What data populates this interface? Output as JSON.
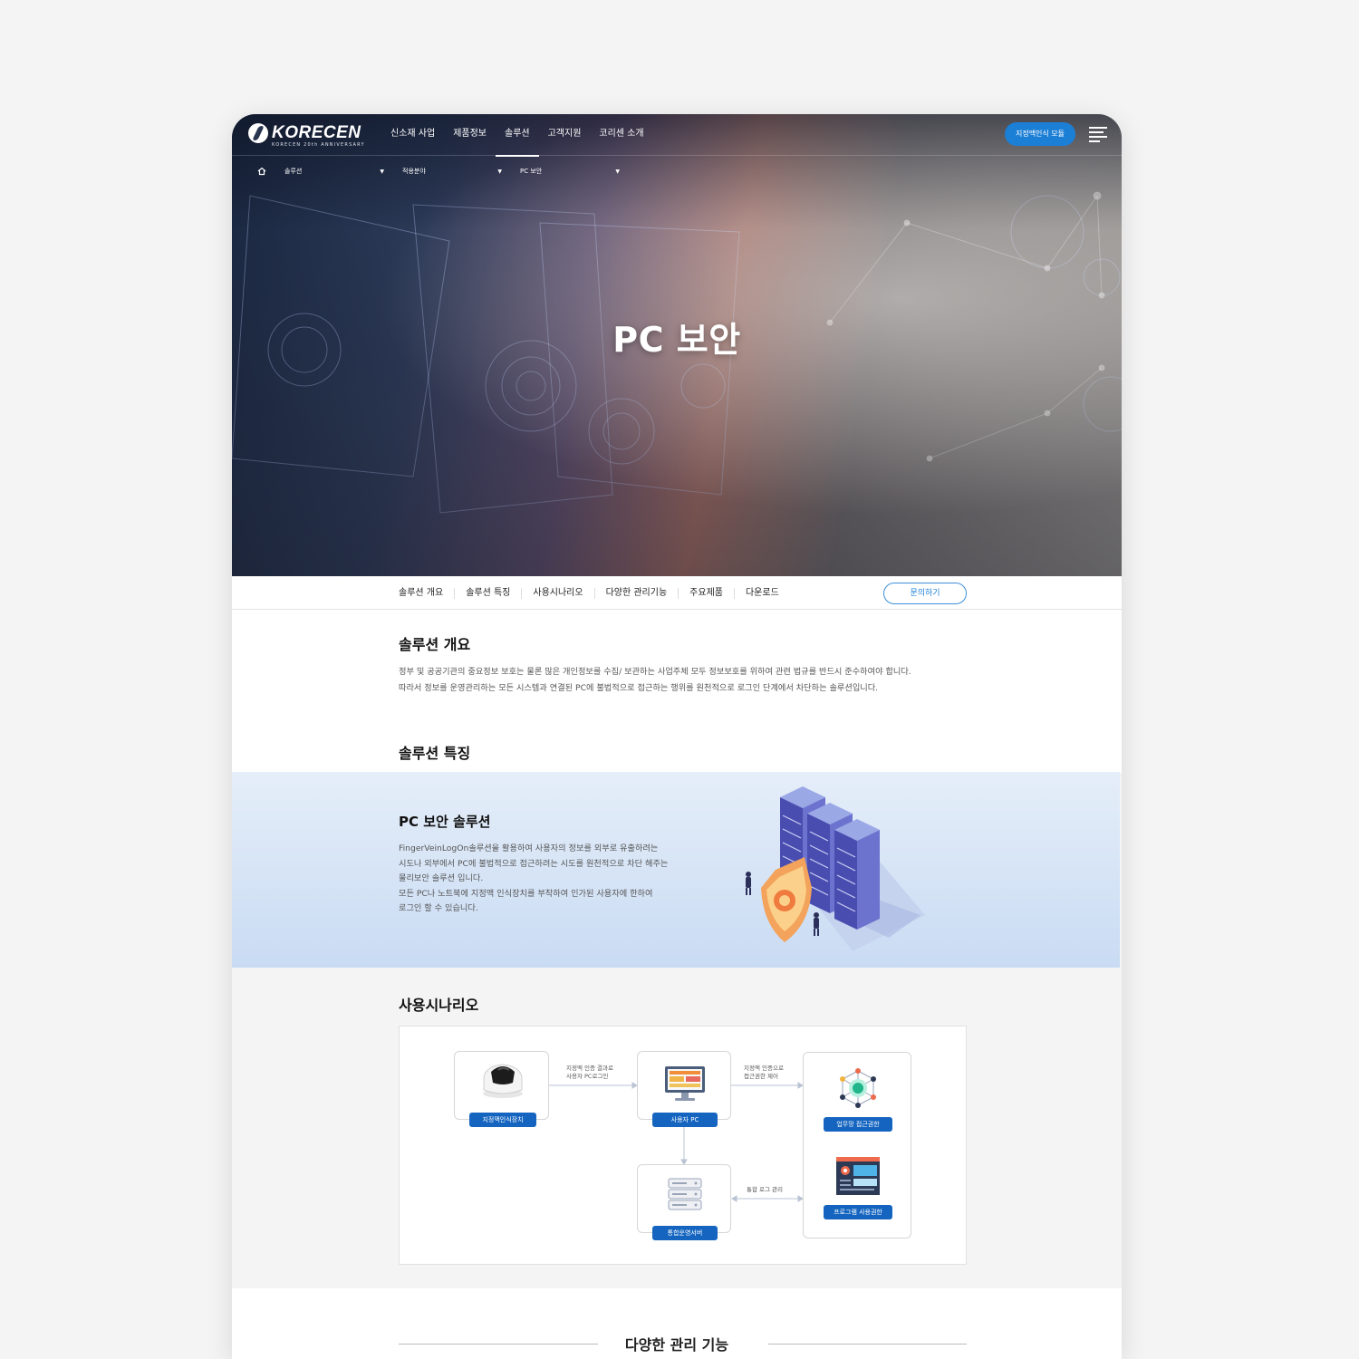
{
  "header": {
    "logo_text": "KORECEN",
    "logo_sub": "KORECEN 20th ANNIVERSARY",
    "nav": [
      "신소재 사업",
      "제품정보",
      "솔루션",
      "고객지원",
      "코리센 소개"
    ],
    "active_nav": "솔루션",
    "module_button": "지정맥인식 모듈"
  },
  "breadcrumb": [
    "솔루션",
    "적용분야",
    "PC 보안"
  ],
  "hero": {
    "title": "PC 보안"
  },
  "subnav": {
    "items": [
      "솔루션 개요",
      "솔루션 특징",
      "사용시나리오",
      "다양한 관리기능",
      "주요제품",
      "다운로드"
    ],
    "inquiry_button": "문의하기"
  },
  "overview": {
    "heading": "솔루션 개요",
    "lines": [
      "정부 및 공공기관의 중요정보 보호는 물론 많은 개인정보를 수집/ 보관하는 사업주체 모두 정보보호를 위하여 관련 법규를 반드시 준수하여야 합니다.",
      "따라서 정보를 운영관리하는 모든 시스템과 연결된 PC에 불법적으로 접근하는 행위를 원천적으로 로그인 단계에서 차단하는 솔루션입니다."
    ]
  },
  "features": {
    "heading": "솔루션 특징",
    "title": "PC 보안 솔루션",
    "lines": [
      "FingerVeinLogOn솔루션을 활용하여 사용자의 정보를 외부로 유출하려는",
      "시도나 외부에서 PC에 불법적으로 접근하려는 시도를 원천적으로 차단 해주는",
      "물리보안 솔루션 입니다.",
      "모든 PC나 노트북에 지정맥 인식장치를 부착하여 인가된 사용자에 한하여",
      "로그인 할 수 있습니다."
    ]
  },
  "scenario": {
    "heading": "사용시나리오",
    "nodes": {
      "device": "지정맥인식장치",
      "pc": "사용자 PC",
      "server": "통합운영서버",
      "access": "업무망 접근권한",
      "program": "프로그램 사용권한"
    },
    "edges": {
      "device_pc": [
        "지정맥 인증 결과로",
        "사용자 PC로그인"
      ],
      "pc_rights": [
        "지정맥 인증으로",
        "접근권한 제어"
      ],
      "server_rights": "통합 로그 관리"
    }
  },
  "management": {
    "heading": "다양한 관리 기능"
  },
  "colors": {
    "accent": "#1c7fd6",
    "label_blue": "#1565c0",
    "feature_bg": "#d4e3f6"
  },
  "icons": [
    "logo-mark",
    "home-icon",
    "caret-down-icon",
    "hamburger-icon",
    "fingervein-device-icon",
    "monitor-icon",
    "server-icon",
    "network-icon",
    "program-window-icon"
  ]
}
